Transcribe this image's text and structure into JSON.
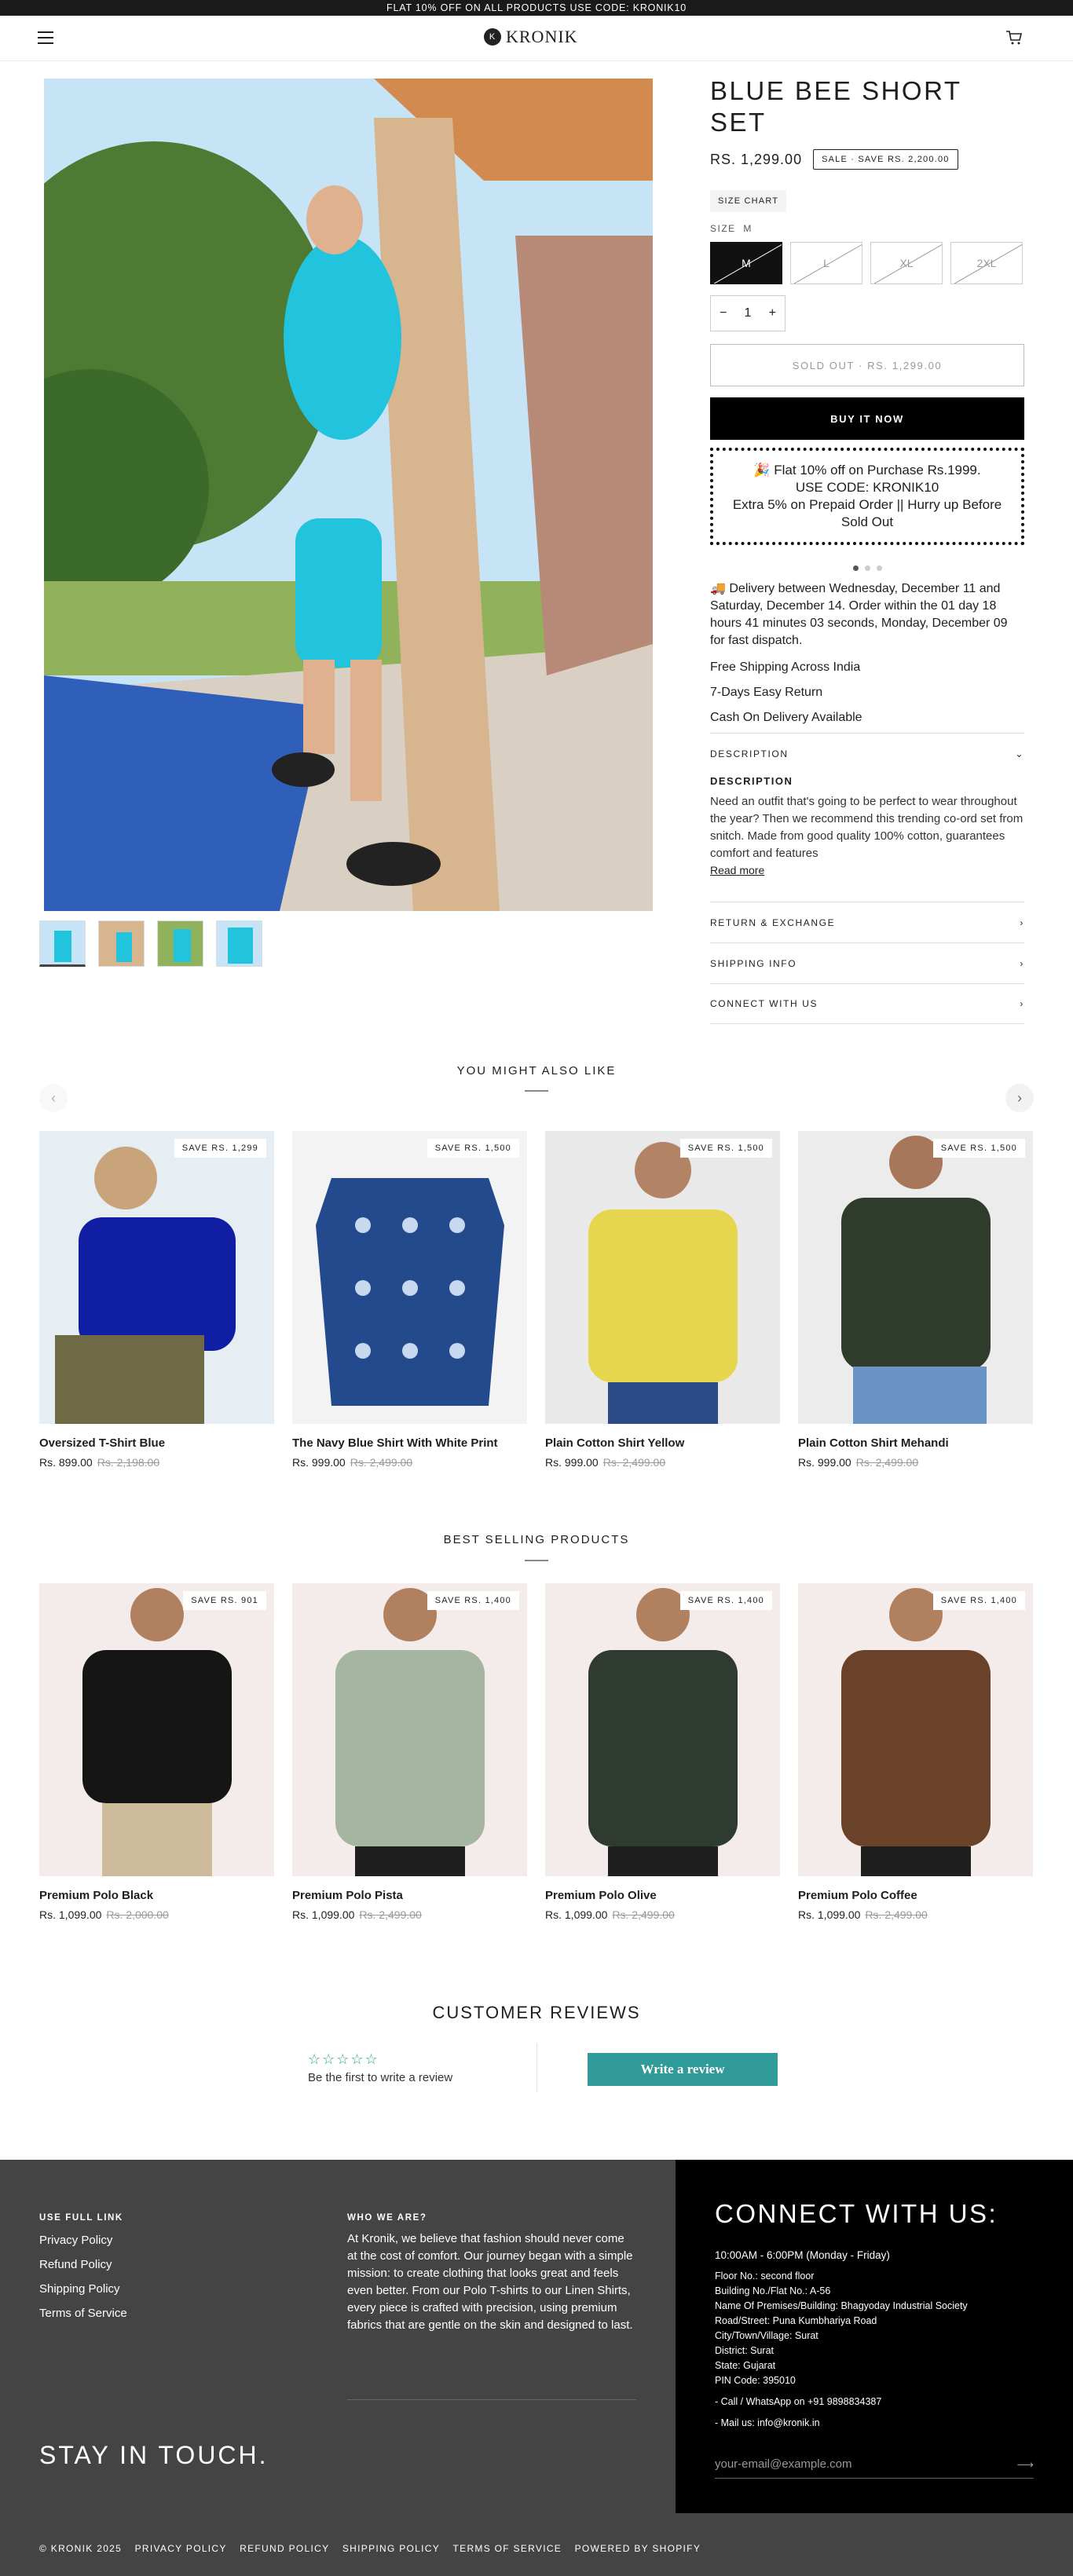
{
  "announcement": "FLAT 10% OFF ON ALL PRODUCTS  USE CODE: KRONIK10",
  "header": {
    "logo": "KRONIK",
    "logo_mark": "K"
  },
  "product": {
    "title": "BLUE BEE SHORT SET",
    "price": "RS. 1,299.00",
    "sale_badge": "SALE  ·  SAVE RS. 2,200.00",
    "size_chart": "SIZE CHART",
    "size_label": "SIZE",
    "size_selected": "M",
    "sizes": [
      "M",
      "L",
      "XL",
      "2XL"
    ],
    "qty": "1",
    "minus": "−",
    "plus": "+",
    "soldout": "SOLD OUT  ·  RS. 1,299.00",
    "buynow": "BUY IT NOW",
    "offer_line1": "🎉 Flat 10% off on Purchase Rs.1999.",
    "offer_line2": "USE CODE: KRONIK10",
    "offer_line3": "Extra 5% on Prepaid Order || Hurry up Before Sold Out",
    "delivery": "🚚 Delivery between Wednesday, December 11 and Saturday, December 14. Order within the 01 day 18 hours 41 minutes 03 seconds, Monday, December 09 for fast dispatch.",
    "perks": [
      "Free Shipping Across India",
      "7-Days Easy Return",
      "Cash On Delivery Available"
    ],
    "description_acc": "DESCRIPTION",
    "description_head": "DESCRIPTION",
    "description_text": "Need an outfit that's going to be perfect to wear throughout the year? Then we recommend this trending co-ord set from snitch. Made from good quality 100% cotton, guarantees comfort and features",
    "read_more": "Read more",
    "accordions": [
      "RETURN & EXCHANGE",
      "SHIPPING INFO",
      "CONNECT WITH US"
    ]
  },
  "also_like": {
    "title": "YOU MIGHT ALSO LIKE",
    "items": [
      {
        "name": "Oversized T-Shirt Blue",
        "price": "Rs. 899.00",
        "compare": "Rs. 2,198.00",
        "save": "SAVE RS. 1,299"
      },
      {
        "name": "The Navy Blue Shirt With White Print",
        "price": "Rs. 999.00",
        "compare": "Rs. 2,499.00",
        "save": "SAVE RS. 1,500"
      },
      {
        "name": "Plain Cotton Shirt Yellow",
        "price": "Rs. 999.00",
        "compare": "Rs. 2,499.00",
        "save": "SAVE RS. 1,500"
      },
      {
        "name": "Plain Cotton Shirt Mehandi",
        "price": "Rs. 999.00",
        "compare": "Rs. 2,499.00",
        "save": "SAVE RS. 1,500"
      }
    ]
  },
  "best_selling": {
    "title": "BEST SELLING PRODUCTS",
    "items": [
      {
        "name": "Premium Polo Black",
        "price": "Rs. 1,099.00",
        "compare": "Rs. 2,000.00",
        "save": "SAVE RS. 901"
      },
      {
        "name": "Premium Polo Pista",
        "price": "Rs. 1,099.00",
        "compare": "Rs. 2,499.00",
        "save": "SAVE RS. 1,400"
      },
      {
        "name": "Premium Polo Olive",
        "price": "Rs. 1,099.00",
        "compare": "Rs. 2,499.00",
        "save": "SAVE RS. 1,400"
      },
      {
        "name": "Premium Polo Coffee",
        "price": "Rs. 1,099.00",
        "compare": "Rs. 2,499.00",
        "save": "SAVE RS. 1,400"
      }
    ]
  },
  "reviews": {
    "title": "CUSTOMER REVIEWS",
    "stars": "☆☆☆☆☆",
    "first": "Be the first to write a review",
    "button": "Write a review"
  },
  "footer": {
    "links_title": "USE FULL LINK",
    "links": [
      "Privacy Policy",
      "Refund Policy",
      "Shipping Policy",
      "Terms of Service"
    ],
    "about_title": "WHO WE ARE?",
    "about_text": "At Kronik, we believe that fashion should never come at the cost of comfort. Our journey began with a simple mission: to create clothing that looks great and feels even better. From our Polo T-shirts to our Linen Shirts, every piece is crafted with precision, using premium fabrics that are gentle on the skin and designed to last.",
    "stay": "STAY IN TOUCH.",
    "connect": "CONNECT WITH US:",
    "hours": "10:00AM - 6:00PM (Monday - Friday)",
    "address": [
      "Floor No.: second floor",
      "Building No./Flat No.: A-56",
      "Name Of Premises/Building: Bhagyoday Industrial Society",
      "Road/Street: Puna Kumbhariya Road",
      "City/Town/Village: Surat",
      "District: Surat",
      "State: Gujarat",
      "PIN Code: 395010"
    ],
    "phone": "- Call / WhatsApp on +91 9898834387",
    "mail": "- Mail us: info@kronik.in",
    "email_placeholder": "your-email@example.com",
    "arrow": "⟶"
  },
  "bottom": [
    "© KRONIK 2025",
    "PRIVACY POLICY",
    "REFUND POLICY",
    "SHIPPING POLICY",
    "TERMS OF SERVICE",
    "POWERED BY SHOPIFY"
  ],
  "colors": {
    "accent": "#2f9a97",
    "dark": "#000000",
    "footer": "#444444"
  }
}
